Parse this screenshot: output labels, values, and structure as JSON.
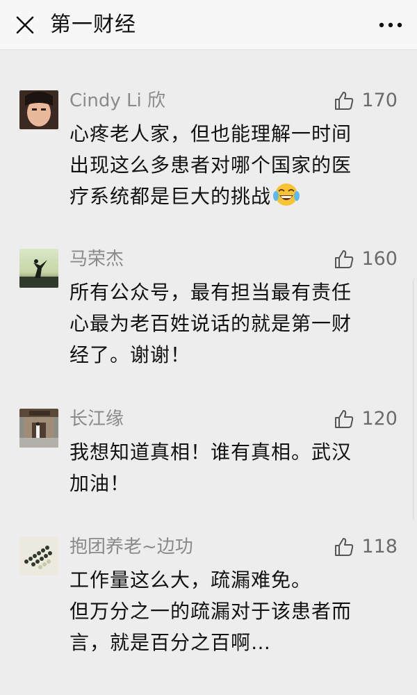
{
  "header": {
    "title": "第一财经",
    "close_icon": "close-icon",
    "more_icon": "more-icon"
  },
  "comments": [
    {
      "nickname": "Cindy Li 欣",
      "likes": "170",
      "text": "心疼老人家，但也能理解一时间\n出现这么多患者对哪个国家的医\n疗系统都是巨大的挑战",
      "emoji": "tears-of-joy-emoji",
      "avatar": "girl-avatar"
    },
    {
      "nickname": "马荣杰",
      "likes": "160",
      "text": "所有公众号，最有担当最有责任\n心最为老百姓说话的就是第一财\n经了。谢谢！",
      "avatar": "dancer-sunset-avatar"
    },
    {
      "nickname": "长江缘",
      "likes": "120",
      "text": "我想知道真相！谁有真相。武汉\n加油！",
      "avatar": "temple-person-avatar"
    },
    {
      "nickname": "抱团养老~边功",
      "likes": "118",
      "text": "工作量这么大，疏漏难免。\n但万分之一的疏漏对于该患者而\n言，就是百分之百啊…",
      "avatar": "beads-avatar"
    }
  ],
  "colors": {
    "background": "#ededed",
    "header_bg": "#f7f7f7",
    "nickname": "#8a8a8a",
    "text": "#111111"
  }
}
